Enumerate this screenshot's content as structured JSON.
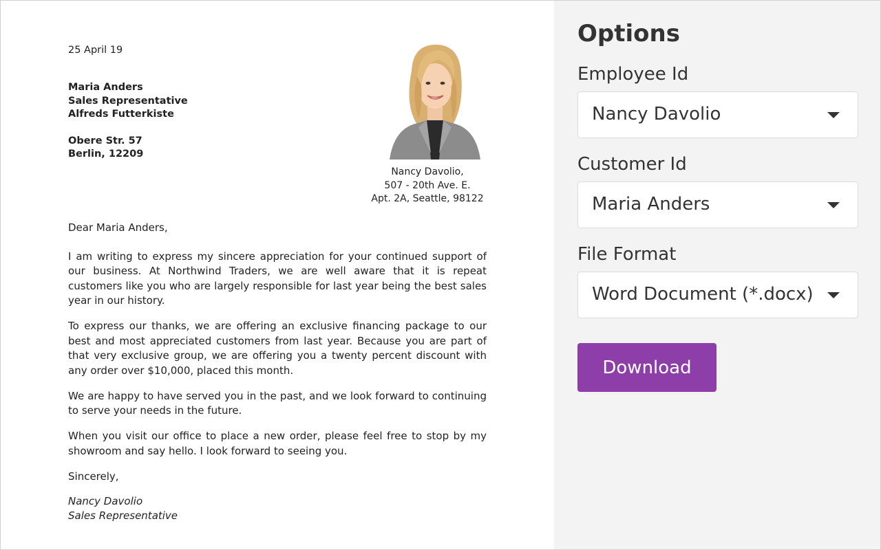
{
  "letter": {
    "date": "25 April 19",
    "recipient": {
      "name": "Maria Anders",
      "title": "Sales Representative",
      "company": "Alfreds Futterkiste",
      "street": "Obere Str. 57",
      "city": "Berlin, 12209"
    },
    "sender": {
      "name": "Nancy Davolio,",
      "address1": "507 - 20th Ave. E.",
      "address2": "Apt. 2A, Seattle, 98122"
    },
    "salutation": "Dear Maria Anders,",
    "paragraphs": [
      "I am writing to express my sincere appreciation for your continued support of our business. At Northwind Traders, we are well aware that it is repeat customers like you who are largely responsible for last year being the best sales year in our history.",
      "To express our thanks, we are offering an exclusive financing package to our best and most appreciated customers from last year. Because you are part of that very exclusive group, we are offering you a twenty percent discount with any order over $10,000, placed this month.",
      "We are happy to have served you in the past, and we look forward to continuing to serve your needs in the future.",
      "When you visit our office to place a new order, please feel free to stop by my showroom and say hello. I look forward to seeing you."
    ],
    "closing": "Sincerely,",
    "signature": {
      "name": "Nancy Davolio",
      "title": "Sales Representative"
    }
  },
  "options": {
    "title": "Options",
    "employee": {
      "label": "Employee Id",
      "value": "Nancy Davolio"
    },
    "customer": {
      "label": "Customer Id",
      "value": "Maria Anders"
    },
    "format": {
      "label": "File Format",
      "value": "Word Document (*.docx)"
    },
    "download_label": "Download"
  },
  "colors": {
    "accent": "#8e3ea8",
    "panel_bg": "#f3f3f3"
  }
}
